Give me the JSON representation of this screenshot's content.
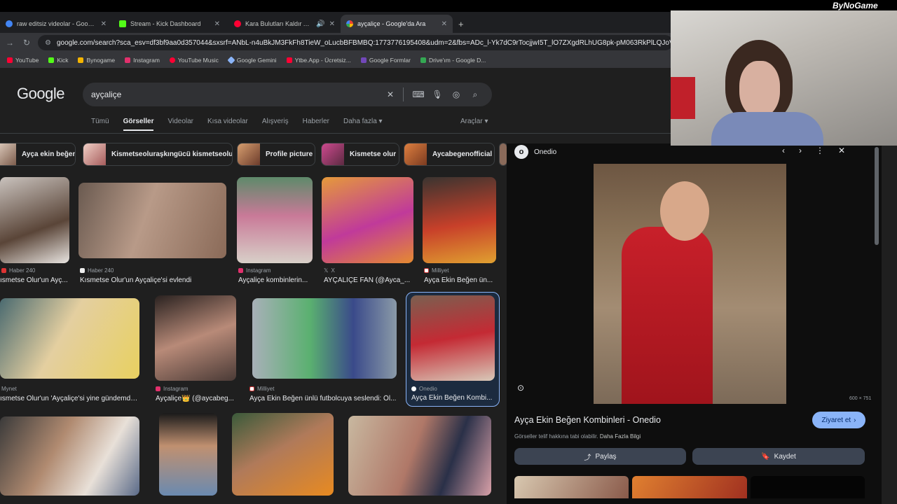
{
  "tabs": [
    {
      "title": "raw editsiz videolar - Google D",
      "color": "#4285f4"
    },
    {
      "title": "Stream - Kick Dashboard",
      "color": "#53fc18"
    },
    {
      "title": "Kara Bulutları Kaldır Aradan",
      "color": "#ff0033"
    },
    {
      "title": "ayçaliçe - Google'da Ara",
      "color": "#ffffff"
    }
  ],
  "new_tab": "+",
  "url": "google.com/search?sca_esv=df3bf9aa0d357044&sxsrf=ANbL-n4uBkJM3FkFh8TieW_oLucbBFBMBQ:1773776195408&udm=2&fbs=ADc_l-Yk7dC9rTocjjwI5T_lO7ZXgdRLhUG8pk-pM063RkPlLQJoVswXu7Xoldd5L",
  "bookmarks": [
    {
      "label": "YouTube",
      "color": "#ff0033"
    },
    {
      "label": "Kick",
      "color": "#53fc18"
    },
    {
      "label": "Bynogame",
      "color": "#f4b400"
    },
    {
      "label": "Instagram",
      "color": "#e1306c"
    },
    {
      "label": "YouTube Music",
      "color": "#ff0033"
    },
    {
      "label": "Google Gemini",
      "color": "#8ab4f8"
    },
    {
      "label": "Ytbe.App - Ücretsiz...",
      "color": "#ff0033"
    },
    {
      "label": "Google Formlar",
      "color": "#7248b9"
    },
    {
      "label": "Drive'ım - Google D...",
      "color": "#34a853"
    }
  ],
  "google": {
    "logo": "Google",
    "query": "ayçaliçe"
  },
  "filters": [
    "Tümü",
    "Görseller",
    "Videolar",
    "Kısa videolar",
    "Alışveriş",
    "Haberler",
    "Daha fazla ▾"
  ],
  "tools": "Araçlar ▾",
  "chips": [
    "Ayça ekin beğen",
    "Kismetseoluraşkıngücü kismetseolur",
    "Profile picture",
    "Kismetse olur",
    "Aycabegenofficial"
  ],
  "results": [
    {
      "source": "Haber 240",
      "caption": "ısmetse Olur'un Ayç..."
    },
    {
      "source": "Haber 240",
      "caption": "Kısmetse Olur'un Ayçaliçe'si evlendi"
    },
    {
      "source": "Instagram",
      "caption": "Ayçaliçe kombinlerin..."
    },
    {
      "source": "X",
      "caption": "AYÇALİÇE FAN (@Ayca_..."
    },
    {
      "source": "Milliyet",
      "caption": "Ayça Ekin Beğen ün..."
    },
    {
      "source": "Mynet",
      "caption": "ısmetse Olur'un 'Ayçaliçe'si yine gündemde!..."
    },
    {
      "source": "Instagram",
      "caption": "Ayçaliçe👑 (@aycabeg..."
    },
    {
      "source": "Milliyet",
      "caption": "Ayça Ekin Beğen ünlü futbolcuya seslendi: Öl..."
    },
    {
      "source": "Onedio",
      "caption": "Ayça Ekin Beğen Kombi..."
    }
  ],
  "panel": {
    "site": "Onedio",
    "logo_letter": "o",
    "dims": "600 × 751",
    "title": "Ayça Ekin Beğen Kombinleri - Onedio",
    "visit": "Ziyaret et",
    "copyright": "Görseller telif hakkına tabi olabilir.",
    "more_info": "Daha Fazla Bilgi",
    "share": "Paylaş",
    "save": "Kaydet"
  },
  "overlay": {
    "brand": "ByNoGame"
  },
  "colors": {
    "bg": "#1f1f1f",
    "accent": "#8ab4f8",
    "selected": "#8ab4f8"
  }
}
